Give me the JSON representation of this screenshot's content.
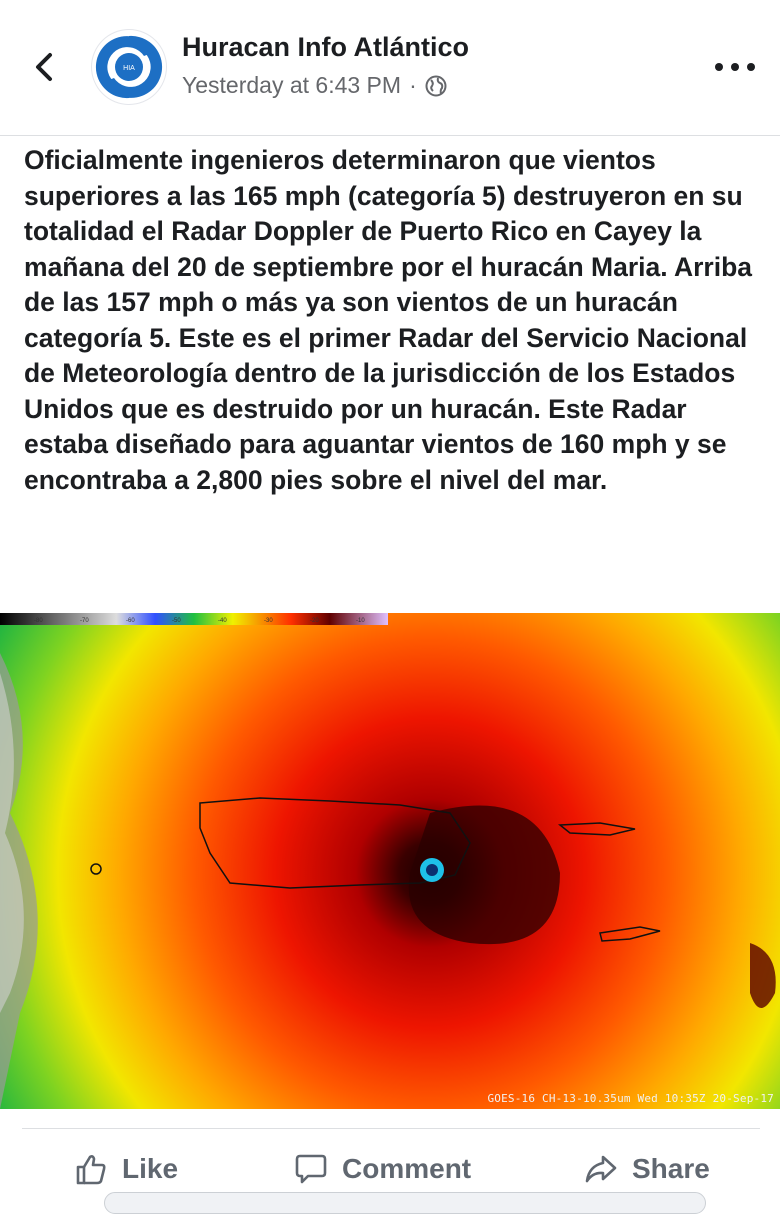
{
  "post": {
    "page_name": "Huracan Info Atlántico",
    "timestamp": "Yesterday at 6:43 PM",
    "separator": "·",
    "privacy_icon": "globe-icon",
    "avatar_icon": "hurricane-logo-icon",
    "avatar_text": "HIA",
    "text": "Oficialmente ingenieros determinaron que vientos superiores a las 165 mph (categoría 5) destruyeron en su totalidad el Radar Doppler de Puerto Rico en Cayey la mañana del 20 de septiembre por el huracán Maria. Arriba de las 157 mph o más ya son vientos de un huracán categoría 5. Este es el primer Radar del Servicio Nacional de Meteorología dentro de la jurisdicción de los Estados Unidos que es destruido por un huracán. Este Radar estaba diseñado para aguantar vientos de 160 mph y se encontraba a 2,800 pies sobre el nivel del mar."
  },
  "image": {
    "caption": "GOES-16 CH-13-10.35um   Wed 10:35Z 20-Sep-17",
    "colorbar_labels": [
      "-80",
      "-70",
      "-60",
      "-50",
      "-40",
      "-30",
      "-20",
      "-10"
    ]
  },
  "actions": {
    "like": "Like",
    "comment": "Comment",
    "share": "Share"
  },
  "colors": {
    "brand": "#1877f2",
    "text": "#1c1e21",
    "meta": "#65676b",
    "action": "#606770"
  }
}
